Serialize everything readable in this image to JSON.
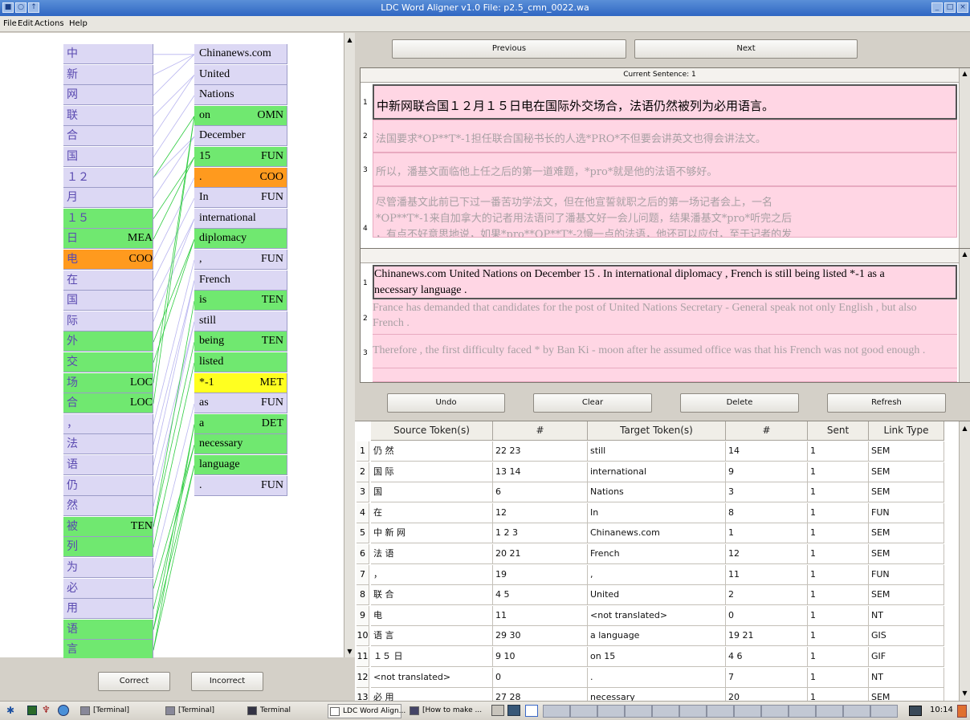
{
  "window": {
    "title": "LDC Word Aligner v1.0  File: p2.5_cmn_0022.wa"
  },
  "menu": {
    "items": [
      "File",
      "Edit",
      "Actions",
      "Help"
    ]
  },
  "source_tokens": [
    {
      "text": "中",
      "tag": "",
      "color": "lav"
    },
    {
      "text": "新",
      "tag": "",
      "color": "lav"
    },
    {
      "text": "网",
      "tag": "",
      "color": "lav"
    },
    {
      "text": "联",
      "tag": "",
      "color": "lav"
    },
    {
      "text": "合",
      "tag": "",
      "color": "lav"
    },
    {
      "text": "国",
      "tag": "",
      "color": "lav"
    },
    {
      "text": "１２",
      "tag": "",
      "color": "lav"
    },
    {
      "text": "月",
      "tag": "",
      "color": "lav"
    },
    {
      "text": "１５",
      "tag": "",
      "color": "grn"
    },
    {
      "text": "日",
      "tag": "MEA",
      "color": "grn"
    },
    {
      "text": "电",
      "tag": "COO",
      "color": "org"
    },
    {
      "text": "在",
      "tag": "",
      "color": "lav"
    },
    {
      "text": "国",
      "tag": "",
      "color": "lav"
    },
    {
      "text": "际",
      "tag": "",
      "color": "lav"
    },
    {
      "text": "外",
      "tag": "",
      "color": "grn"
    },
    {
      "text": "交",
      "tag": "",
      "color": "grn"
    },
    {
      "text": "场",
      "tag": "LOC",
      "color": "grn"
    },
    {
      "text": "合",
      "tag": "LOC",
      "color": "grn"
    },
    {
      "text": "，",
      "tag": "",
      "color": "lav"
    },
    {
      "text": "法",
      "tag": "",
      "color": "lav"
    },
    {
      "text": "语",
      "tag": "",
      "color": "lav"
    },
    {
      "text": "仍",
      "tag": "",
      "color": "lav"
    },
    {
      "text": "然",
      "tag": "",
      "color": "lav"
    },
    {
      "text": "被",
      "tag": "TEN",
      "color": "grn"
    },
    {
      "text": "列",
      "tag": "",
      "color": "grn"
    },
    {
      "text": "为",
      "tag": "",
      "color": "lav"
    },
    {
      "text": "必",
      "tag": "",
      "color": "lav"
    },
    {
      "text": "用",
      "tag": "",
      "color": "lav"
    },
    {
      "text": "语",
      "tag": "",
      "color": "grn"
    },
    {
      "text": "言",
      "tag": "",
      "color": "grn"
    }
  ],
  "target_tokens": [
    {
      "text": "Chinanews.com",
      "tag": "",
      "color": "lav"
    },
    {
      "text": "United",
      "tag": "",
      "color": "lav"
    },
    {
      "text": "Nations",
      "tag": "",
      "color": "lav"
    },
    {
      "text": "on",
      "tag": "OMN",
      "color": "grn"
    },
    {
      "text": "December",
      "tag": "",
      "color": "lav"
    },
    {
      "text": "15",
      "tag": "FUN",
      "color": "grn"
    },
    {
      "text": ".",
      "tag": "COO",
      "color": "org"
    },
    {
      "text": "In",
      "tag": "FUN",
      "color": "lav"
    },
    {
      "text": "international",
      "tag": "",
      "color": "lav"
    },
    {
      "text": "diplomacy",
      "tag": "",
      "color": "grn"
    },
    {
      "text": ",",
      "tag": "FUN",
      "color": "lav"
    },
    {
      "text": "French",
      "tag": "",
      "color": "lav"
    },
    {
      "text": "is",
      "tag": "TEN",
      "color": "grn"
    },
    {
      "text": "still",
      "tag": "",
      "color": "lav"
    },
    {
      "text": "being",
      "tag": "TEN",
      "color": "grn"
    },
    {
      "text": "listed",
      "tag": "",
      "color": "grn"
    },
    {
      "text": "*-1",
      "tag": "MET",
      "color": "yel"
    },
    {
      "text": "as",
      "tag": "FUN",
      "color": "lav"
    },
    {
      "text": "a",
      "tag": "DET",
      "color": "grn"
    },
    {
      "text": "necessary",
      "tag": "",
      "color": "grn"
    },
    {
      "text": "language",
      "tag": "",
      "color": "grn"
    },
    {
      "text": ".",
      "tag": "FUN",
      "color": "lav"
    }
  ],
  "links": [
    [
      0,
      0
    ],
    [
      1,
      0
    ],
    [
      2,
      0
    ],
    [
      3,
      1
    ],
    [
      4,
      1
    ],
    [
      5,
      2
    ],
    [
      6,
      3
    ],
    [
      6,
      4
    ],
    [
      7,
      4
    ],
    [
      8,
      5
    ],
    [
      9,
      5
    ],
    [
      10,
      6
    ],
    [
      11,
      7
    ],
    [
      12,
      8
    ],
    [
      13,
      8
    ],
    [
      14,
      9
    ],
    [
      15,
      9
    ],
    [
      16,
      3
    ],
    [
      17,
      3
    ],
    [
      18,
      10
    ],
    [
      19,
      11
    ],
    [
      20,
      11
    ],
    [
      21,
      13
    ],
    [
      22,
      13
    ],
    [
      23,
      12
    ],
    [
      23,
      14
    ],
    [
      24,
      15
    ],
    [
      25,
      17
    ],
    [
      26,
      19
    ],
    [
      27,
      19
    ],
    [
      28,
      20
    ],
    [
      29,
      20
    ],
    [
      28,
      18
    ],
    [
      29,
      18
    ]
  ],
  "buttons": {
    "previous": "Previous",
    "next": "Next",
    "correct": "Correct",
    "incorrect": "Incorrect",
    "undo": "Undo",
    "clear": "Clear",
    "delete": "Delete",
    "refresh": "Refresh"
  },
  "current_sentence": "Current Sentence: 1",
  "source_sentences": [
    {
      "num": "1",
      "text": "中新网联合国１２月１５日电在国际外交场合，法语仍然被列为必用语言。",
      "active": true
    },
    {
      "num": "2",
      "text": "法国要求*OP**T*-1担任联合国秘书长的人选*PRO*不但要会讲英文也得会讲法文。",
      "active": false
    },
    {
      "num": "3",
      "text": "所以，潘基文面临他上任之后的第一道难题，*pro*就是他的法语不够好。",
      "active": false
    },
    {
      "num": "4",
      "text_lines": [
        "尽管潘基文此前已下过一番苦功学法文，但在他宣誓就职之后的第一场记者会上，一名",
        "*OP**T*-1来自加拿大的记者用法语问了潘基文好一会儿问题，结果潘基文*pro*听完之后",
        "，有点不好意思地说，如果*pro**OP**T*-2慢一点的法语，他还可以应付，至于记者的发"
      ],
      "active": false
    }
  ],
  "target_sentences": [
    {
      "num": "1",
      "text_lines": [
        "Chinanews.com United Nations on December 15 . In international diplomacy , French is still being listed *-1 as a",
        "necessary language ."
      ],
      "active": true
    },
    {
      "num": "2",
      "text_lines": [
        "France has demanded that candidates for the post of United Nations Secretary - General speak not only English , but also",
        "French ."
      ],
      "active": false
    },
    {
      "num": "3",
      "text_lines": [
        "Therefore , the first difficulty faced * by Ban Ki - moon after he assumed office was that his French was not good enough ."
      ],
      "active": false
    }
  ],
  "table": {
    "headers": [
      "Source Token(s)",
      "#",
      "Target Token(s)",
      "#",
      "Sent",
      "Link Type"
    ],
    "rows": [
      [
        "1",
        "仍 然",
        "22 23",
        "still",
        "14",
        "1",
        "SEM"
      ],
      [
        "2",
        "国 际",
        "13 14",
        "international",
        "9",
        "1",
        "SEM"
      ],
      [
        "3",
        "国",
        "6",
        "Nations",
        "3",
        "1",
        "SEM"
      ],
      [
        "4",
        "在",
        "12",
        "In",
        "8",
        "1",
        "FUN"
      ],
      [
        "5",
        "中 新 网",
        "1 2 3",
        "Chinanews.com",
        "1",
        "1",
        "SEM"
      ],
      [
        "6",
        "法 语",
        "20 21",
        "French",
        "12",
        "1",
        "SEM"
      ],
      [
        "7",
        "，",
        "19",
        ",",
        "11",
        "1",
        "FUN"
      ],
      [
        "8",
        "联 合",
        "4 5",
        "United",
        "2",
        "1",
        "SEM"
      ],
      [
        "9",
        "电",
        "11",
        "<not translated>",
        "0",
        "1",
        "NT"
      ],
      [
        "10",
        "语 言",
        "29 30",
        "a language",
        "19 21",
        "1",
        "GIS"
      ],
      [
        "11",
        "１５ 日",
        "9 10",
        "on 15",
        "4 6",
        "1",
        "GIF"
      ],
      [
        "12",
        "<not translated>",
        "0",
        ".",
        "7",
        "1",
        "NT"
      ],
      [
        "13",
        "必 用",
        "27 28",
        "necessary",
        "20",
        "1",
        "SEM"
      ]
    ]
  },
  "taskbar": {
    "tasks": [
      "[Terminal]",
      "[Terminal]",
      "Terminal",
      "LDC Word Align...",
      "[How to make ..."
    ],
    "clock": "10:14"
  },
  "colors": {
    "lav": "#dcd8f4",
    "grn": "#70e870",
    "org": "#ff9a1e",
    "yel": "#ffff20",
    "link_green": "#2ecc40",
    "link_lav": "#b8b4f0"
  }
}
